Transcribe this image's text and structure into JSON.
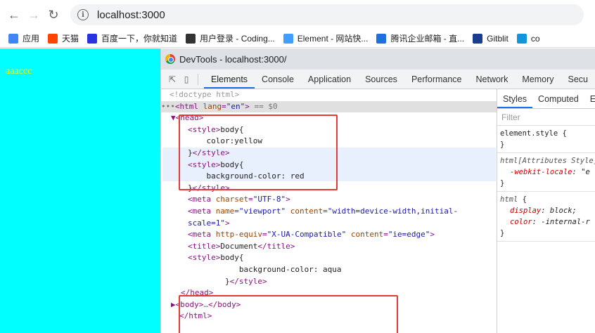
{
  "browser": {
    "url": "localhost:3000",
    "bookmarks": [
      {
        "label": "应用",
        "icon": "apps-icon",
        "color": "#4285f4"
      },
      {
        "label": "天猫",
        "icon": "tmall-icon",
        "color": "#ff4400"
      },
      {
        "label": "百度一下，你就知道",
        "icon": "baidu-icon",
        "color": "#2932e1"
      },
      {
        "label": "用户登录 - Coding...",
        "icon": "coding-icon",
        "color": "#333333"
      },
      {
        "label": "Element - 网站快...",
        "icon": "element-icon",
        "color": "#409eff"
      },
      {
        "label": "腾讯企业邮箱 - 直...",
        "icon": "tencent-mail-icon",
        "color": "#1f6fde"
      },
      {
        "label": "Gitblit",
        "icon": "gitblit-icon",
        "color": "#1a3d8f"
      },
      {
        "label": "co",
        "icon": "co-icon",
        "color": "#1296db"
      }
    ]
  },
  "page": {
    "body_text": "aaaccc",
    "background": "#00ffff",
    "text_color": "#ffff00"
  },
  "devtools": {
    "title": "DevTools - localhost:3000/",
    "tabs": [
      "Elements",
      "Console",
      "Application",
      "Sources",
      "Performance",
      "Network",
      "Memory",
      "Secu"
    ],
    "active_tab": "Elements",
    "dom": {
      "doctype": "<!doctype html>",
      "html_open_prefix": "•••",
      "html_tag_open": "<html ",
      "html_attr": "lang",
      "html_attr_val": "\"en\"",
      "html_tag_close": ">",
      "html_suffix": " == $0",
      "head_open": "▼<head>",
      "style1_open": "<style>",
      "style1_sel": "body{",
      "style1_decl": "    color:yellow",
      "style1_close_brace": "}",
      "style1_close": "</style>",
      "style2_open": "<style>",
      "style2_sel": "body{",
      "style2_decl": "    background-color: red",
      "style2_close_brace": "}",
      "style2_close": "</style>",
      "meta1_tag": "<meta ",
      "meta1_attr": "charset",
      "meta1_val": "\"UTF-8\"",
      "meta1_end": ">",
      "meta2_tag": "<meta ",
      "meta2_attr1": "name",
      "meta2_val1": "\"viewport\"",
      "meta2_attr2": " content",
      "meta2_val2": "\"width=device-width,initial-",
      "meta2_val2b": "scale=1\"",
      "meta2_end": ">",
      "meta3_tag": "<meta ",
      "meta3_attr1": "http-equiv",
      "meta3_val1": "\"X-UA-Compatible\"",
      "meta3_attr2": " content",
      "meta3_val2": "\"ie=edge\"",
      "meta3_end": ">",
      "title_open": "<title>",
      "title_text": "Document",
      "title_close": "</title>",
      "style3_open": "<style>",
      "style3_sel": "body{",
      "style3_decl": "           background-color: aqua",
      "style3_close_brace": "        }",
      "style3_close": "</style>",
      "head_close": "</head>",
      "body_open": "▶<body>",
      "body_ellipsis": "…",
      "body_close": "</body>",
      "html_close": "</html>"
    },
    "styles_panel": {
      "tabs": [
        "Styles",
        "Computed",
        "E"
      ],
      "filter_placeholder": "Filter",
      "element_style": "element.style {",
      "close_brace": "}",
      "rule1_selector": "html[Attributes Style]",
      "rule1_brace": " {",
      "rule1_prop": "-webkit-locale",
      "rule1_val": ": \"e",
      "rule2_selector": "html",
      "rule2_brace": " {",
      "rule2_prop1": "display",
      "rule2_val1": ": block;",
      "rule2_prop2": "color",
      "rule2_val2": ": -internal-r"
    }
  }
}
